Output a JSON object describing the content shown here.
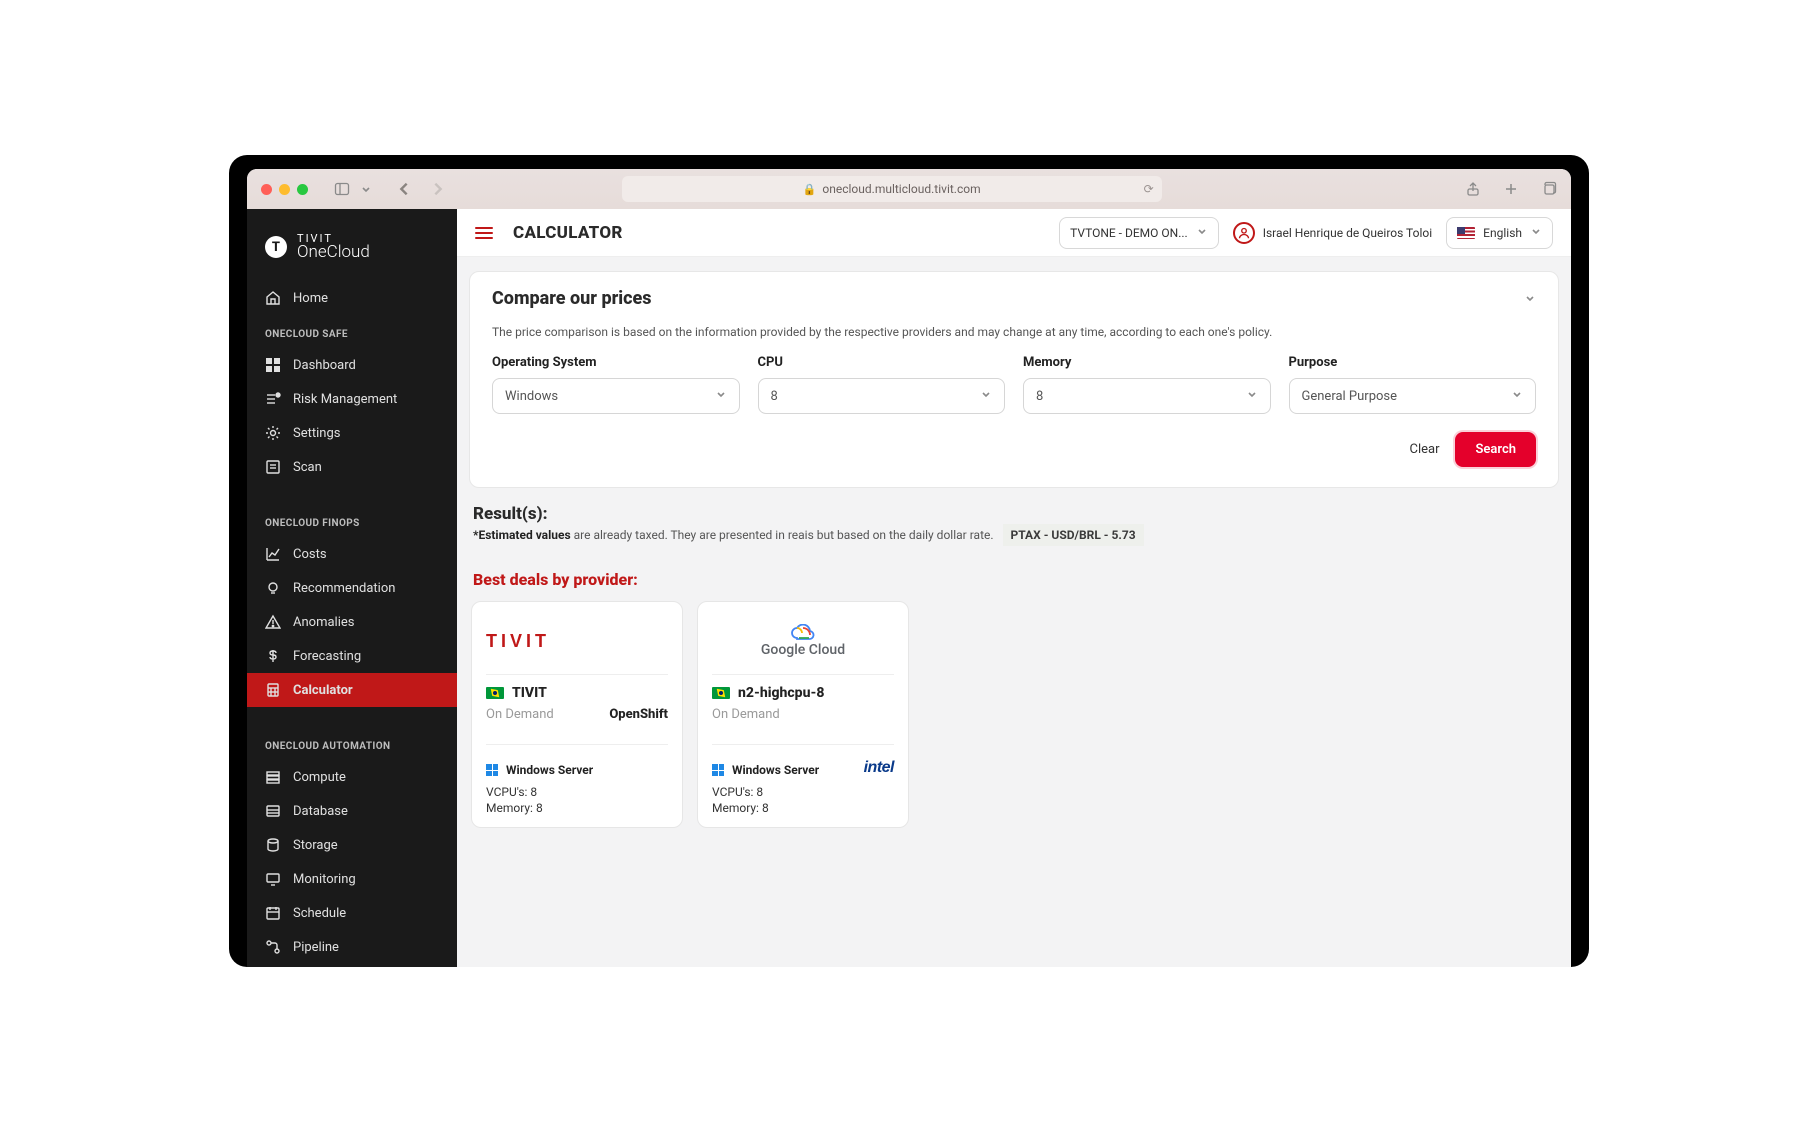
{
  "browser": {
    "url": "onecloud.multicloud.tivit.com"
  },
  "brand": {
    "line1": "TIVIT",
    "line2": "OneCloud"
  },
  "sidebar": {
    "home": "Home",
    "groups": [
      {
        "label": "ONECLOUD SAFE",
        "items": [
          {
            "label": "Dashboard",
            "icon": "dashboard"
          },
          {
            "label": "Risk Management",
            "icon": "risk"
          },
          {
            "label": "Settings",
            "icon": "settings"
          },
          {
            "label": "Scan",
            "icon": "scan"
          }
        ]
      },
      {
        "label": "ONECLOUD FINOPS",
        "items": [
          {
            "label": "Costs",
            "icon": "costs"
          },
          {
            "label": "Recommendation",
            "icon": "bulb"
          },
          {
            "label": "Anomalies",
            "icon": "alert"
          },
          {
            "label": "Forecasting",
            "icon": "dollar"
          },
          {
            "label": "Calculator",
            "icon": "calculator",
            "active": true
          }
        ]
      },
      {
        "label": "ONECLOUD AUTOMATION",
        "items": [
          {
            "label": "Compute",
            "icon": "compute"
          },
          {
            "label": "Database",
            "icon": "database"
          },
          {
            "label": "Storage",
            "icon": "storage"
          },
          {
            "label": "Monitoring",
            "icon": "monitoring"
          },
          {
            "label": "Schedule",
            "icon": "schedule"
          },
          {
            "label": "Pipeline",
            "icon": "pipeline"
          }
        ]
      }
    ]
  },
  "topbar": {
    "title": "CALCULATOR",
    "tenant": "TVTONE - DEMO ON...",
    "user": "Israel Henrique de Queiros Toloi",
    "language": "English"
  },
  "compare": {
    "title": "Compare our prices",
    "info": "The price comparison is based on the information provided by the respective providers and may change at any time, according to each one's policy.",
    "fields": {
      "os": {
        "label": "Operating System",
        "value": "Windows"
      },
      "cpu": {
        "label": "CPU",
        "value": "8"
      },
      "memory": {
        "label": "Memory",
        "value": "8"
      },
      "purpose": {
        "label": "Purpose",
        "value": "General Purpose"
      }
    },
    "clear": "Clear",
    "search": "Search"
  },
  "results": {
    "title": "Result(s):",
    "note_bold": "*Estimated values",
    "note_rest": " are already taxed. They are presented in reais but based on the daily dollar rate.",
    "ptax": "PTAX - USD/BRL - 5.73",
    "deals_title": "Best deals by provider:",
    "cards": [
      {
        "providerLogo": "tivit",
        "name": "TIVIT",
        "pricing": "On Demand",
        "badge": "OpenShift",
        "os": "Windows Server",
        "chip": "",
        "vcpu": "VCPU's: 8",
        "memory": "Memory: 8"
      },
      {
        "providerLogo": "gcloud",
        "gcloudText": "Google Cloud",
        "name": "n2-highcpu-8",
        "pricing": "On Demand",
        "badge": "",
        "os": "Windows Server",
        "chip": "intel",
        "vcpu": "VCPU's: 8",
        "memory": "Memory: 8"
      }
    ]
  }
}
